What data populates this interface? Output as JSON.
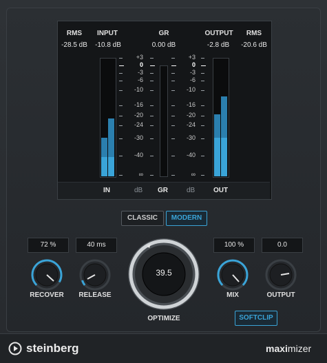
{
  "meters": {
    "rms_in_label": "RMS",
    "input_label": "INPUT",
    "gr_label": "GR",
    "output_label": "OUTPUT",
    "rms_out_label": "RMS",
    "rms_in_value": "-28.5 dB",
    "input_value": "-10.8 dB",
    "gr_value": "0.00 dB",
    "output_value": "-2.8 dB",
    "rms_out_value": "-20.6 dB",
    "scale_left": [
      "+3",
      "0",
      "-3",
      "-6",
      "-10",
      "-16",
      "-20",
      "-24",
      "-30",
      "-40",
      "∞"
    ],
    "scale_right": [
      "+3",
      "0",
      "-3",
      "-6",
      "-10",
      "-16",
      "-20",
      "-24",
      "-30",
      "-40",
      "∞"
    ],
    "in_label": "IN",
    "db_left_label": "dB",
    "gr_bottom_label": "GR",
    "db_right_label": "dB",
    "out_label": "OUT"
  },
  "modes": {
    "classic_label": "CLASSIC",
    "modern_label": "MODERN",
    "selected": "MODERN"
  },
  "controls": {
    "recover": {
      "label": "RECOVER",
      "value": "72 %"
    },
    "release": {
      "label": "RELEASE",
      "value": "40 ms"
    },
    "optimize": {
      "label": "OPTIMIZE",
      "value": "39.5"
    },
    "mix": {
      "label": "MIX",
      "value": "100 %"
    },
    "output": {
      "label": "OUTPUT",
      "value": "0.0"
    },
    "softclip_label": "SOFTCLIP"
  },
  "footer": {
    "brand": "steinberg",
    "product_bold": "maxi",
    "product_rest": "mizer"
  },
  "colors": {
    "accent": "#3aa4d8",
    "background": "#272a2e"
  }
}
